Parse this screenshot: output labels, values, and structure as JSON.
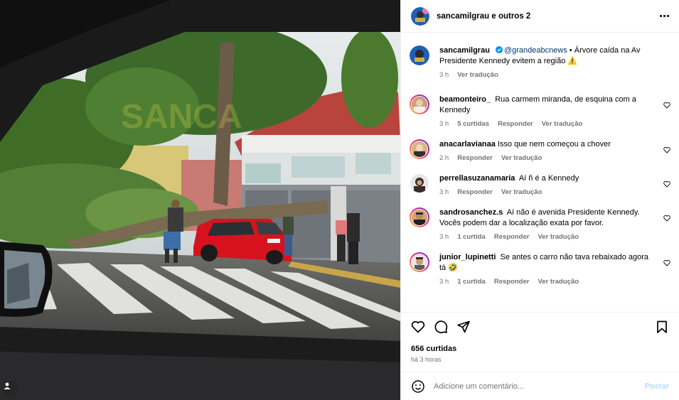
{
  "header": {
    "username": "sancamilgrau",
    "others": "e outros 2"
  },
  "caption": {
    "username": "sancamilgrau",
    "mention": "@grandeabcnews",
    "text": " • Árvore caída na Av Presidente Kennedy evitem a região ⚠️",
    "time": "3 h",
    "translate": "Ver tradução"
  },
  "comments": [
    {
      "username": "beamonteiro_",
      "text": "Rua carmem miranda, de esquina com a Kennedy",
      "time": "3 h",
      "likes": "5 curtidas",
      "reply": "Responder",
      "translate": "Ver tradução"
    },
    {
      "username": "anacarlavianaa",
      "text": "Isso que nem começou a chover",
      "time": "2 h",
      "likes": "",
      "reply": "Responder",
      "translate": "Ver tradução"
    },
    {
      "username": "perrellasuzanamaria",
      "text": "Aí ñ é a Kennedy",
      "time": "3 h",
      "likes": "",
      "reply": "Responder",
      "translate": "Ver tradução"
    },
    {
      "username": "sandrosanchez.s",
      "text": "Aí não é avenida Presidente Kennedy. Vocês podem dar a localização exata por favor.",
      "time": "3 h",
      "likes": "1 curtida",
      "reply": "Responder",
      "translate": "Ver tradução"
    },
    {
      "username": "junior_lupinetti",
      "text": "Se antes o carro não tava rebaixado agora tá 🤣",
      "time": "3 h",
      "likes": "1 curtida",
      "reply": "Responder",
      "translate": "Ver tradução"
    }
  ],
  "post": {
    "likes": "656 curtidas",
    "posted": "há 3 horas"
  },
  "add_comment": {
    "placeholder": "Adicione um comentário...",
    "post_label": "Postar"
  },
  "colors": {
    "link": "#00376b",
    "muted": "#737373",
    "post_disabled": "#b2dffc",
    "verified": "#0095f6",
    "car_red": "#d7121f"
  },
  "icons": [
    "more-options-icon",
    "verified-badge-icon",
    "heart-icon",
    "comment-icon",
    "share-icon",
    "save-icon",
    "emoji-icon",
    "user-tag-icon"
  ]
}
